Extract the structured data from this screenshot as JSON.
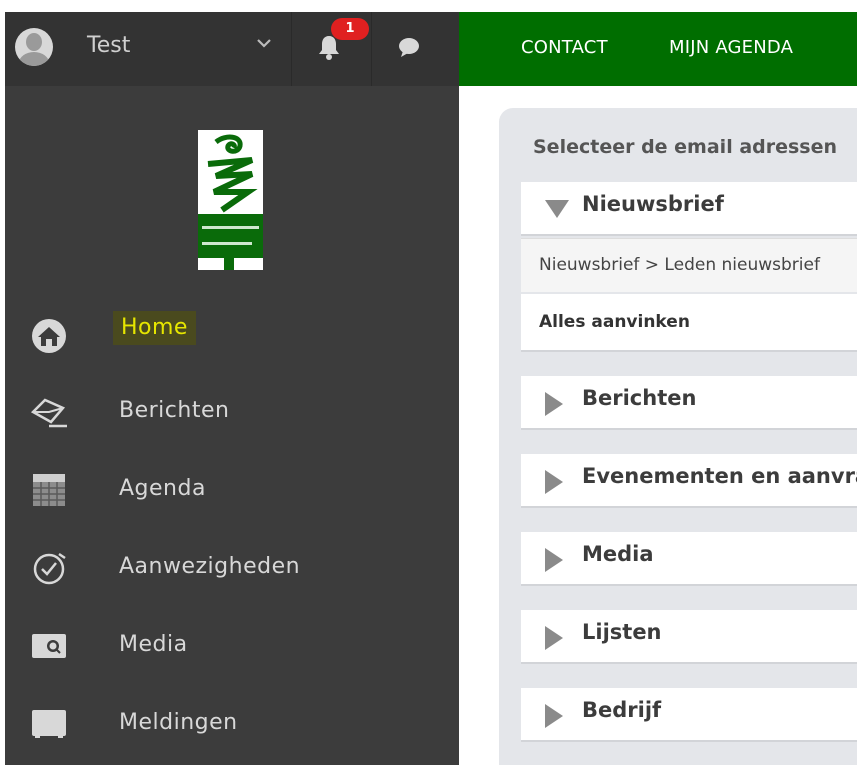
{
  "user": {
    "name": "Test"
  },
  "notifications": {
    "count": "1"
  },
  "sidebar": {
    "items": [
      {
        "label": "Home",
        "icon": "home-icon",
        "active": true
      },
      {
        "label": "Berichten",
        "icon": "mail-icon"
      },
      {
        "label": "Agenda",
        "icon": "calendar-icon"
      },
      {
        "label": "Aanwezigheden",
        "icon": "clock-check-icon"
      },
      {
        "label": "Media",
        "icon": "camera-icon"
      },
      {
        "label": "Meldingen",
        "icon": "notification-icon"
      }
    ]
  },
  "topnav": {
    "items": [
      "CONTACT",
      "MIJN AGENDA"
    ]
  },
  "main": {
    "title": "Selecteer de email adressen",
    "sections": [
      {
        "label": "Nieuwsbrief",
        "expanded": true
      },
      {
        "label": "Berichten"
      },
      {
        "label": "Evenementen en aanvragen"
      },
      {
        "label": "Media"
      },
      {
        "label": "Lijsten"
      },
      {
        "label": "Bedrijf"
      }
    ],
    "breadcrumb": "Nieuwsbrief > Leden nieuwsbrief",
    "check_all": "Alles aanvinken"
  },
  "colors": {
    "sidebar": "#3c3c3c",
    "topnav": "#006e00",
    "active": "#e6e600",
    "badge": "#e02020"
  }
}
